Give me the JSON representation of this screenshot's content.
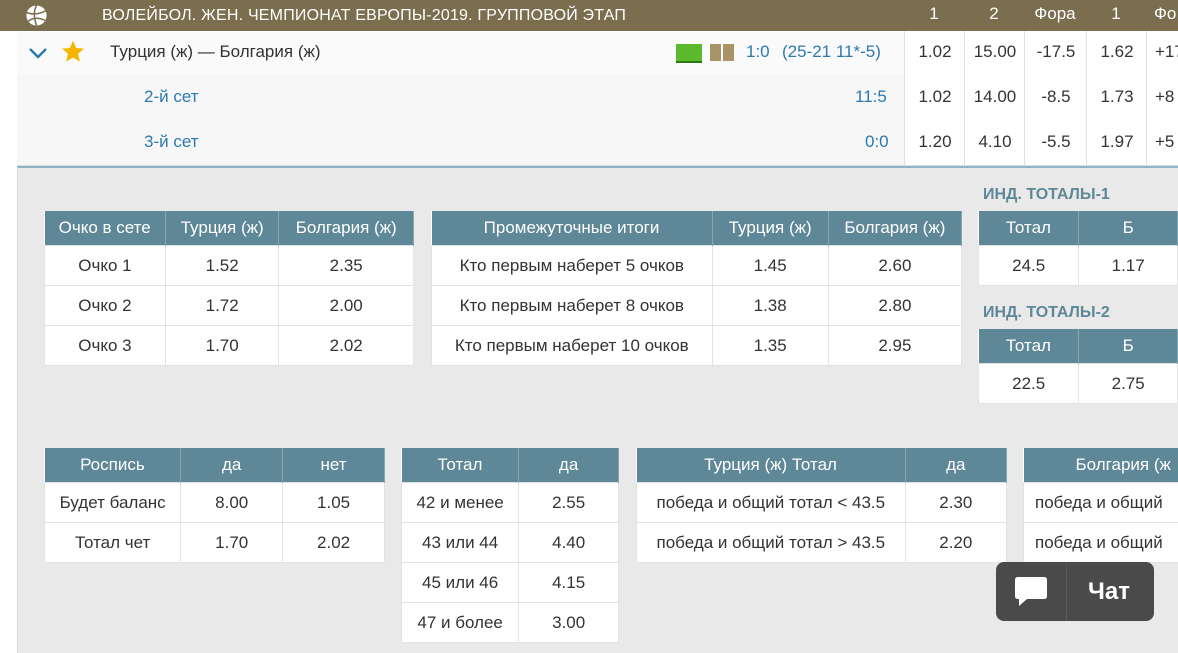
{
  "header": {
    "title": "ВОЛЕЙБОЛ. ЖЕН. ЧЕМПИОНАТ ЕВРОПЫ-2019. ГРУППОВОЙ ЭТАП",
    "cols": [
      "1",
      "2",
      "Фора",
      "1",
      "Фо"
    ]
  },
  "match": {
    "teams": "Турция (ж) — Болгария (ж)",
    "score": "1:0",
    "sets": "(25-21 11*-5)",
    "odds": [
      "1.02",
      "15.00",
      "-17.5",
      "1.62",
      "+17"
    ]
  },
  "sets": [
    {
      "name": "2-й сет",
      "score": "11:5",
      "odds": [
        "1.02",
        "14.00",
        "-8.5",
        "1.73",
        "+8"
      ]
    },
    {
      "name": "3-й сет",
      "score": "0:0",
      "odds": [
        "1.20",
        "4.10",
        "-5.5",
        "1.97",
        "+5"
      ]
    }
  ],
  "ochko": {
    "headers": [
      "Очко в сете",
      "Турция (ж)",
      "Болгария (ж)"
    ],
    "rows": [
      [
        "Очко 1",
        "1.52",
        "2.35"
      ],
      [
        "Очко 2",
        "1.72",
        "2.00"
      ],
      [
        "Очко 3",
        "1.70",
        "2.02"
      ]
    ]
  },
  "prom": {
    "headers": [
      "Промежуточные итоги",
      "Турция (ж)",
      "Болгария (ж)"
    ],
    "rows": [
      [
        "Кто первым наберет 5 очков",
        "1.45",
        "2.60"
      ],
      [
        "Кто первым наберет 8 очков",
        "1.38",
        "2.80"
      ],
      [
        "Кто первым наберет 10 очков",
        "1.35",
        "2.95"
      ]
    ]
  },
  "ind1": {
    "title": "ИНД. ТОТАЛЫ-1",
    "headers": [
      "Тотал",
      "Б"
    ],
    "row": [
      "24.5",
      "1.17"
    ]
  },
  "ind2": {
    "title": "ИНД. ТОТАЛЫ-2",
    "headers": [
      "Тотал",
      "Б"
    ],
    "row": [
      "22.5",
      "2.75"
    ]
  },
  "rospis": {
    "headers": [
      "Роспись",
      "да",
      "нет"
    ],
    "rows": [
      [
        "Будет баланс",
        "8.00",
        "1.05"
      ],
      [
        "Тотал чет",
        "1.70",
        "2.02"
      ]
    ]
  },
  "total": {
    "headers": [
      "Тотал",
      "да"
    ],
    "rows": [
      [
        "42 и менее",
        "2.55"
      ],
      [
        "43 или 44",
        "4.40"
      ],
      [
        "45 или 46",
        "4.15"
      ],
      [
        "47 и более",
        "3.00"
      ]
    ]
  },
  "turtot": {
    "headers": [
      "Турция (ж) Тотал",
      "да"
    ],
    "rows": [
      [
        "победа и общий тотал < 43.5",
        "2.30"
      ],
      [
        "победа и общий тотал > 43.5",
        "2.20"
      ]
    ]
  },
  "boltot": {
    "headers": [
      "Болгария (ж"
    ],
    "rows": [
      [
        "победа и общий"
      ],
      [
        "победа и общий"
      ]
    ]
  },
  "chat": {
    "label": "Чат"
  },
  "colors": {
    "header_bg": "#7a6e4f",
    "table_head": "#5e8797",
    "link": "#2a7ab0",
    "star": "#f4b400"
  }
}
